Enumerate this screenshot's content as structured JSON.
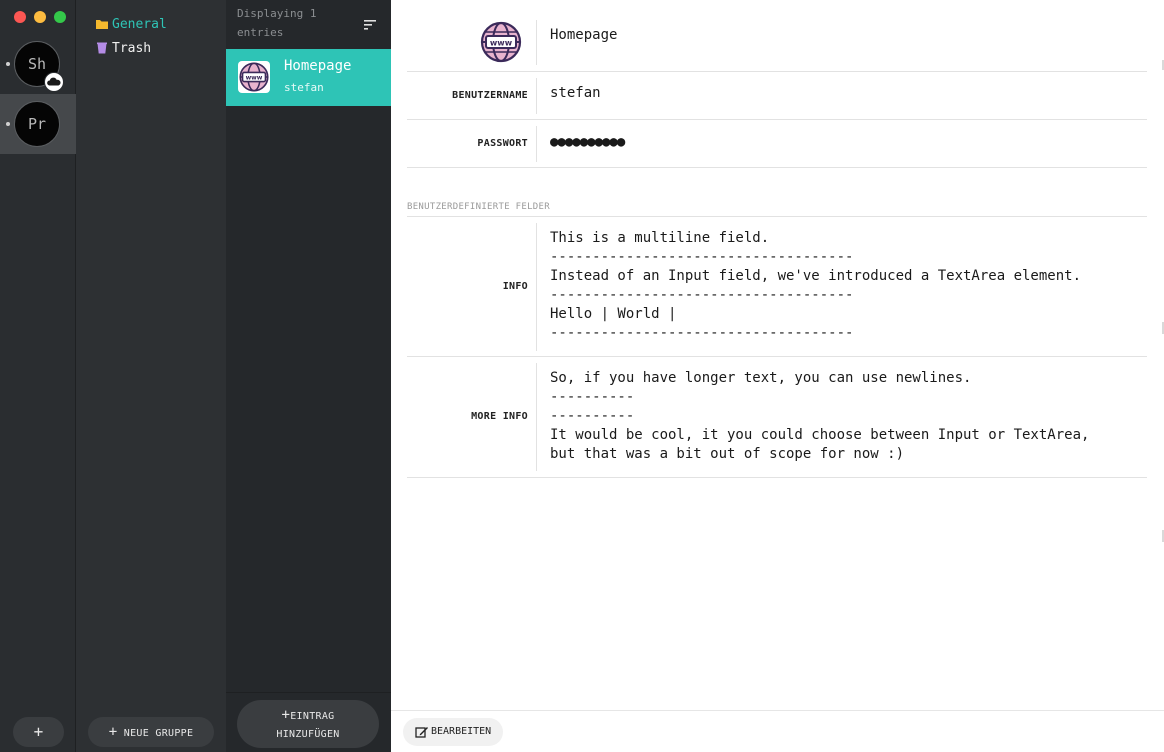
{
  "archives": {
    "items": [
      {
        "initials": "Sh",
        "has_cloud": true,
        "active": false
      },
      {
        "initials": "Pr",
        "has_cloud": false,
        "active": true
      }
    ],
    "add_label": "+"
  },
  "groups": {
    "items": [
      {
        "label": "General",
        "icon": "folder-icon",
        "color": "#f5b92e",
        "active": true
      },
      {
        "label": "Trash",
        "icon": "trash-icon",
        "color": "#b48ce6",
        "active": false
      }
    ],
    "new_group_label": "NEUE GRUPPE"
  },
  "entries": {
    "count_text": "Displaying 1 entries",
    "items": [
      {
        "title": "Homepage",
        "username": "stefan",
        "icon": "www-globe-icon",
        "selected": true
      }
    ],
    "add_entry_label_line1": "EINTRAG",
    "add_entry_label_line2": "HINZUFÜGEN"
  },
  "detail": {
    "title": "Homepage",
    "fields": [
      {
        "label": "BENUTZERNAME",
        "value": "stefan"
      },
      {
        "label": "PASSWORT",
        "value": "●●●●●●●●●●"
      }
    ],
    "custom_section_title": "BENUTZERDEFINIERTE FELDER",
    "custom_fields": [
      {
        "label": "INFO",
        "value": "This is a multiline field.\n------------------------------------\nInstead of an Input field, we've introduced a TextArea element.\n------------------------------------\nHello | World |\n------------------------------------"
      },
      {
        "label": "MORE INFO",
        "value": "So, if you have longer text, you can use newlines.\n----------\n----------\nIt would be cool, it you could choose between Input or TextArea,\nbut that was a bit out of scope for now :)"
      }
    ],
    "edit_label": "BEARBEITEN"
  },
  "colors": {
    "accent": "#2ec4b6",
    "sidebar_dark": "#2a2d30",
    "entries_bg": "#25282b"
  }
}
